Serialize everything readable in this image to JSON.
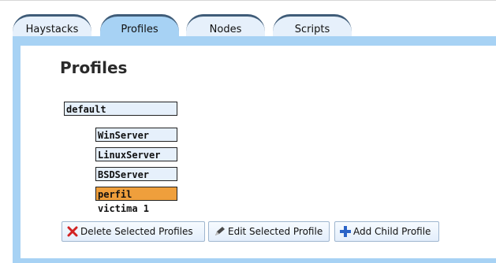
{
  "tabs": [
    {
      "label": "Haystacks"
    },
    {
      "label": "Profiles"
    },
    {
      "label": "Nodes"
    },
    {
      "label": "Scripts"
    }
  ],
  "active_tab": "Profiles",
  "page": {
    "title": "Profiles"
  },
  "profiles": {
    "root": "default",
    "children": [
      "WinServer",
      "LinuxServer",
      "BSDServer",
      "perfil victima 1"
    ],
    "selected": "perfil victima 1"
  },
  "buttons": {
    "delete": "Delete Selected Profiles",
    "edit": "Edit Selected Profile",
    "add_child": "Add Child Profile"
  },
  "colors": {
    "panel": "#a7d2f4",
    "tab_inactive": "#e6f0fb",
    "tab_border": "#3f5c78",
    "profile_bg": "#e6f0fb",
    "selected_bg": "#ef9f3c",
    "delete_icon": "#d22222",
    "add_icon": "#2a63c7"
  },
  "icons": {
    "delete": "delete-x-icon",
    "edit": "pencil-icon",
    "add": "plus-icon"
  }
}
